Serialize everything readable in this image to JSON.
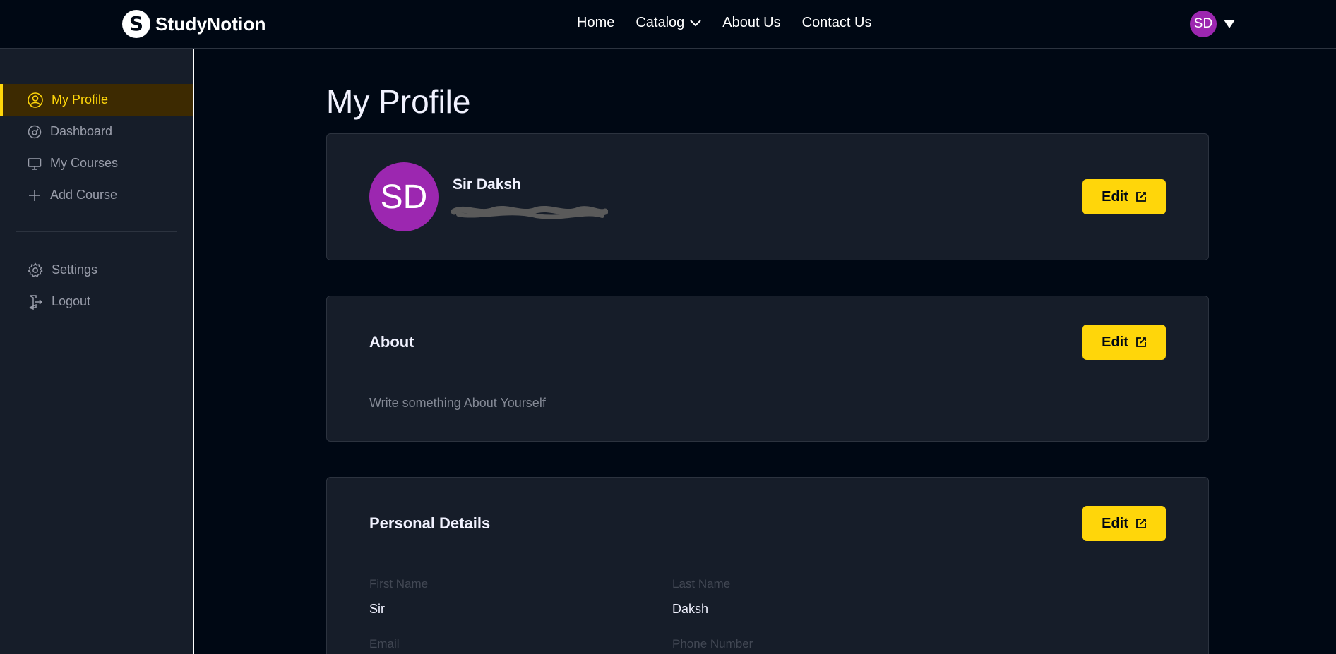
{
  "navbar": {
    "brand": "StudyNotion",
    "brand_initial": "S",
    "links": [
      "Home",
      "Catalog",
      "About Us",
      "Contact Us"
    ],
    "user_initials": "SD"
  },
  "sidebar": {
    "items": [
      {
        "label": "My Profile",
        "icon": "user-circle-icon",
        "active": true
      },
      {
        "label": "Dashboard",
        "icon": "speedometer-icon"
      },
      {
        "label": "My Courses",
        "icon": "monitor-icon"
      },
      {
        "label": "Add Course",
        "icon": "plus-icon"
      }
    ],
    "bottom_items": [
      {
        "label": "Settings",
        "icon": "gear-icon"
      },
      {
        "label": "Logout",
        "icon": "logout-icon"
      }
    ]
  },
  "main": {
    "title": "My Profile",
    "profile_card": {
      "initials": "SD",
      "name": "Sir Daksh",
      "edit_label": "Edit"
    },
    "about_card": {
      "heading": "About",
      "text": "Write something About Yourself",
      "edit_label": "Edit"
    },
    "personal_card": {
      "heading": "Personal Details",
      "edit_label": "Edit",
      "fields": [
        {
          "label": "First Name",
          "value": "Sir"
        },
        {
          "label": "Last Name",
          "value": "Daksh"
        },
        {
          "label": "Email",
          "value": ""
        },
        {
          "label": "Phone Number",
          "value": ""
        }
      ]
    }
  },
  "colors": {
    "background": "#000814",
    "card": "#161d29",
    "accent": "#ffd60a",
    "avatar": "#9c27b0",
    "active_bg": "#3d2a01"
  }
}
